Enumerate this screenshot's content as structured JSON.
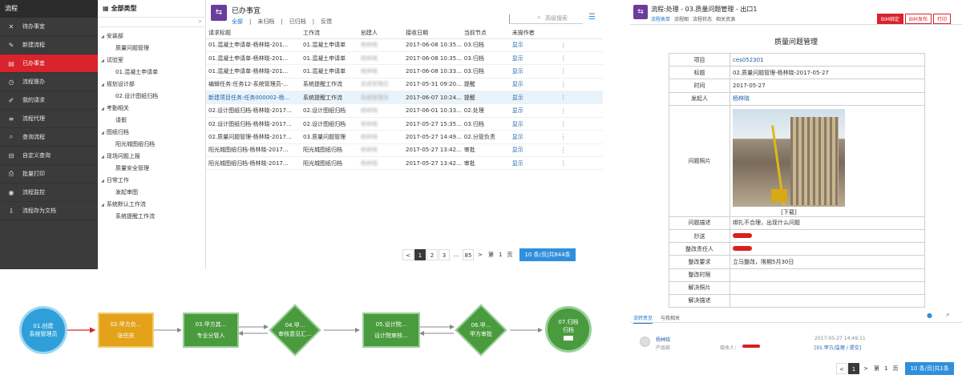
{
  "sidebar": {
    "title": "流程",
    "items": [
      {
        "label": "待办事宜",
        "icon": "close-x-icon"
      },
      {
        "label": "新建流程",
        "icon": "edit-icon"
      },
      {
        "label": "已办事宜",
        "icon": "document-icon",
        "active": true
      },
      {
        "label": "流程督办",
        "icon": "clock-icon"
      },
      {
        "label": "我的请求",
        "icon": "pencil-icon"
      },
      {
        "label": "流程代理",
        "icon": "list-icon"
      },
      {
        "label": "查询流程",
        "icon": "search-icon"
      },
      {
        "label": "自定义查询",
        "icon": "filter-icon"
      },
      {
        "label": "批量打印",
        "icon": "printer-icon"
      },
      {
        "label": "流程监控",
        "icon": "monitor-icon"
      },
      {
        "label": "流程存为文档",
        "icon": "save-icon"
      }
    ]
  },
  "tree": {
    "title": "全部类型",
    "nodes": [
      {
        "label": "安装部",
        "level": 0
      },
      {
        "label": "质量问题管理",
        "level": 1
      },
      {
        "label": "试验室",
        "level": 0
      },
      {
        "label": "01.混凝土申请单",
        "level": 1
      },
      {
        "label": "规划设计部",
        "level": 0
      },
      {
        "label": "02.设计图纸归档",
        "level": 1
      },
      {
        "label": "考勤相关",
        "level": 0
      },
      {
        "label": "请假",
        "level": 1
      },
      {
        "label": "图纸归档",
        "level": 0
      },
      {
        "label": "阳光城图纸归档",
        "level": 1
      },
      {
        "label": "现场问题上报",
        "level": 0
      },
      {
        "label": "质量安全管理",
        "level": 1
      },
      {
        "label": "日常工作",
        "level": 0
      },
      {
        "label": "发起审图",
        "level": 1
      },
      {
        "label": "系统默认工作流",
        "level": 0
      },
      {
        "label": "系统提醒工作流",
        "level": 1
      }
    ]
  },
  "main": {
    "title": "已办事宜",
    "tabs": [
      "全部",
      "未归档",
      "已归档",
      "反馈"
    ],
    "search_placeholder": "高级搜索",
    "columns": [
      "请求标题",
      "工作流",
      "创建人",
      "接收日期",
      "当前节点",
      "未操作者"
    ],
    "rows": [
      [
        "01.混凝土申请单-杨林晓-201...",
        "01.混凝土申请单",
        "杨林晓",
        "2017-06-08 10:35...",
        "03.归档",
        "显示"
      ],
      [
        "01.混凝土申请单-杨林晓-201...",
        "01.混凝土申请单",
        "杨林晓",
        "2017-06-08 10:35...",
        "03.归档",
        "显示"
      ],
      [
        "01.混凝土申请单-杨林晓-201...",
        "01.混凝土申请单",
        "杨林晓",
        "2017-06-08 10:33...",
        "03.归档",
        "显示"
      ],
      [
        "编辑任务:任务12-系统管理员-...",
        "系统提醒工作流",
        "系统管理员",
        "2017-05-31 09:20...",
        "提醒",
        "显示"
      ],
      [
        "新建项目任务:任务000002-杨...",
        "系统提醒工作流",
        "系统管理员",
        "2017-06-07 10:24...",
        "提醒",
        "显示"
      ],
      [
        "02.设计图纸归档-杨林晓-2017...",
        "02.设计图纸归档",
        "杨林晓",
        "2017-06-01 10:33...",
        "02.处理",
        "显示"
      ],
      [
        "02.设计图纸归档-杨林晓-2017...",
        "02.设计图纸归档",
        "杨林晓",
        "2017-05-27 15:35...",
        "03.归档",
        "显示"
      ],
      [
        "02.质量问题管理-杨林晓-2017...",
        "03.质量问题管理",
        "杨林晓",
        "2017-05-27 14:49...",
        "02.分管负责",
        "显示"
      ],
      [
        "阳光城图纸归档-杨林晓-2017...",
        "阳光城图纸归档",
        "杨林晓",
        "2017-05-27 13:42...",
        "审批",
        "显示"
      ],
      [
        "阳光城图纸归档-杨林晓-2017...",
        "阳光城图纸归档",
        "杨林晓",
        "2017-05-27 13:42...",
        "审批",
        "显示"
      ]
    ],
    "highlight_row": 4,
    "pager": {
      "prev": "<",
      "pages": [
        "1",
        "2",
        "3",
        "...",
        "85"
      ],
      "next": ">",
      "goto_label": "第",
      "goto_value": "1",
      "goto_unit": "页",
      "size": "10",
      "size_suffix": "条/页|共844条"
    }
  },
  "flow": {
    "nodes": [
      {
        "l1": "01.创建",
        "l2": "系统管理员"
      },
      {
        "l1": "02.甲方负...",
        "l2": "张任庆"
      },
      {
        "l1": "03.甲方其...",
        "l2": "专业分管人"
      },
      {
        "l1": "04.甲...",
        "l2": "审核意见汇..."
      },
      {
        "l1": "05.设计院...",
        "l2": "设计院审核..."
      },
      {
        "l1": "06.甲...",
        "l2": "甲方审批"
      },
      {
        "l1": "07.归档",
        "l2": "归档"
      }
    ]
  },
  "right": {
    "title": "流程:处理 - 03.质量问题管理 - 出口1",
    "tabs": [
      "流程表单",
      "流程图",
      "流程状态",
      "相关资源"
    ],
    "buttons": [
      "BIM绑定",
      "BIM发布",
      "打印"
    ],
    "form_title": "质量问题管理",
    "fields": [
      {
        "label": "项目",
        "value": "ces052301",
        "link": true
      },
      {
        "label": "标题",
        "value": "02.质量问题管理-杨林晓-2017-05-27"
      },
      {
        "label": "时间",
        "value": "2017-05-27"
      },
      {
        "label": "发起人",
        "value": "杨林晓",
        "link": true
      },
      {
        "label": "问题照片",
        "value": "[下载]",
        "photo": true
      },
      {
        "label": "问题描述",
        "value": "绑扎不合理，出现什么问题"
      },
      {
        "label": "抄送",
        "value": "",
        "redacted": true
      },
      {
        "label": "整改责任人",
        "value": "",
        "redacted": true
      },
      {
        "label": "整改要求",
        "value": "立马整改，限期5月30日"
      },
      {
        "label": "整改时限",
        "value": ""
      },
      {
        "label": "解决照片",
        "value": ""
      },
      {
        "label": "解决描述",
        "value": ""
      }
    ],
    "bottom_tabs": [
      "流转意见",
      "与我相关"
    ],
    "comment": {
      "name": "杨林晓",
      "dept": "产品部",
      "receiver_label": "接收人：",
      "time": "2017-05-27   14:49:11",
      "node": "[01.甲方/监理 / 提交]"
    },
    "pager": {
      "prev": "<",
      "page": "1",
      "next": ">",
      "goto_label": "第",
      "goto_value": "1",
      "goto_unit": "页",
      "size": "10",
      "size_suffix": "条/页|共1条"
    }
  }
}
